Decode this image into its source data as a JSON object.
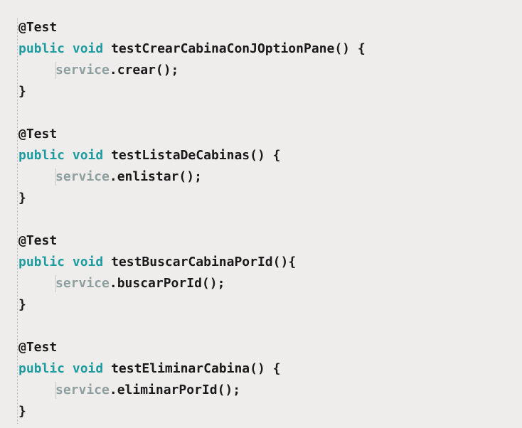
{
  "code": {
    "blocks": [
      {
        "annotation": "@Test",
        "keywords": "public void",
        "method_name": "testCrearCabinaConJOptionPane",
        "signature_tail": "() {",
        "receiver": "service",
        "call": ".crear();",
        "close": "}"
      },
      {
        "annotation": "@Test",
        "keywords": "public void",
        "method_name": "testListaDeCabinas",
        "signature_tail": "() {",
        "receiver": "service",
        "call": ".enlistar();",
        "close": "}"
      },
      {
        "annotation": "@Test",
        "keywords": "public void",
        "method_name": "testBuscarCabinaPorId",
        "signature_tail": "(){",
        "receiver": "service",
        "call": ".buscarPorId();",
        "close": "}"
      },
      {
        "annotation": "@Test",
        "keywords": "public void",
        "method_name": "testEliminarCabina",
        "signature_tail": "() {",
        "receiver": "service",
        "call": ".eliminarPorId();",
        "close": "}"
      }
    ]
  },
  "colors": {
    "background": "#efecec",
    "keyword": "#1d9ca0",
    "field": "#8e9fa0",
    "text": "#1a1a1a"
  }
}
